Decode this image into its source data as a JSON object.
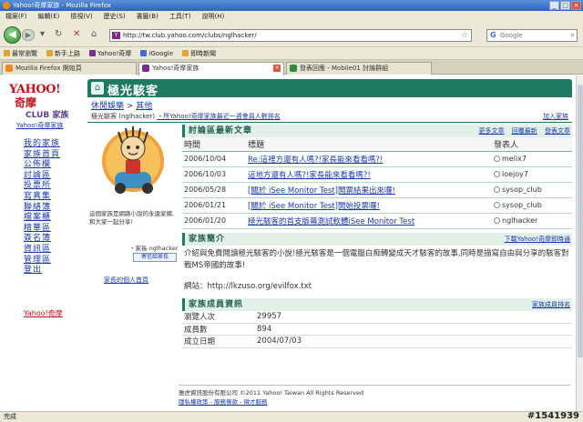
{
  "window": {
    "title": "Yahoo!奇摩家族 - Mozilla Firefox"
  },
  "menu": [
    "檔案(F)",
    "編輯(E)",
    "檢視(V)",
    "歷史(S)",
    "書籤(B)",
    "工具(T)",
    "說明(H)"
  ],
  "nav": {
    "url": "http://tw.club.yahoo.com/clubs/nglhacker/",
    "search_placeholder": "Google"
  },
  "bookmarks": [
    "最常瀏覽",
    "新手上路",
    "Yahoo!奇摩",
    "iGoogle",
    "即時新聞"
  ],
  "tabs": [
    {
      "label": "Mozilla Firefox 開始頁",
      "active": false
    },
    {
      "label": "Yahoo!奇摩家族",
      "active": true
    },
    {
      "label": "發表回應 - Mobile01 討論群組",
      "active": false
    }
  ],
  "logo": {
    "line1": "YAHOO!",
    "line2": "奇摩",
    "line3": "CLUB 家族",
    "sub": "Yahoo!奇摩家族"
  },
  "sidebar": {
    "items": [
      "我的家族",
      "家族首頁",
      "公佈欄",
      "討論區",
      "投票所",
      "寫真集",
      "聯絡簿",
      "檔案櫃",
      "精華區",
      "簽名簿",
      "資訊區",
      "管理區",
      "登出"
    ],
    "footer": "Yahoo!奇摩"
  },
  "header": {
    "title": "極光駭客"
  },
  "breadcrumb": {
    "part1": "休閒娛樂",
    "sep": " > ",
    "part2": "其他"
  },
  "subbar": {
    "text1": "極光駭客 (nglhacker)",
    "text2": "・所Yahoo!奇摩家族最近一週會員人數排名",
    "right": "加入家族"
  },
  "profile": {
    "desc": "這個家族是網路小說的永遠家鄉,和大家一起分享!",
    "host": "・家長 nglhacker",
    "host_button": "寄信給家長",
    "link": "家長的個人首頁"
  },
  "posts": {
    "title": "討論區最新文章",
    "links": [
      "更多文章",
      "回覆最新",
      "發表文章"
    ],
    "headers": [
      "時間",
      "標題",
      "發表人"
    ],
    "rows": [
      {
        "date": "2006/10/04",
        "title": "Re:這裡方還有人嗎?!家長能來看看嗎?!",
        "author": "melix7"
      },
      {
        "date": "2006/10/03",
        "title": "這地方還有人嗎?!家長能來看看嗎?!",
        "author": "loejoy7"
      },
      {
        "date": "2006/05/28",
        "title": "[關於 iSee Monitor Test]開票結果出來囉!",
        "author": "sysop_club"
      },
      {
        "date": "2006/01/21",
        "title": "[關於 iSee Monitor Test]開始投票囉!",
        "author": "sysop_club"
      },
      {
        "date": "2006/01/20",
        "title": "極光駭客的首支版幕測試軟體iSee Monitor Test",
        "author": "nglhacker"
      }
    ]
  },
  "intro": {
    "title": "家族簡介",
    "link": "下載Yahoo!奇摩即時通",
    "text": "介紹與免費閱讀極光駭客的小說!極光駭客是一個電腦白痴轉變成天才駭客的故事,同時是描寫自由與分享的駭客對戰MS帝國的故事!",
    "site": "網站：http://lkzuso.org/evilfox.txt"
  },
  "stats": {
    "title": "家族成員資訊",
    "link": "家族成員排名",
    "rows": [
      {
        "label": "瀏覽人次",
        "value": "29957"
      },
      {
        "label": "成員數",
        "value": "894"
      },
      {
        "label": "成立日期",
        "value": "2004/07/03"
      }
    ]
  },
  "footer": {
    "line1": "雅虎資訊股份有限公司 ©2011 Yahoo! Taiwan All Rights Reserved",
    "line2": "隱私權政策 - 服務條款 - 徵才服務"
  },
  "status": {
    "text": "完成"
  },
  "watermark": "#1541939"
}
